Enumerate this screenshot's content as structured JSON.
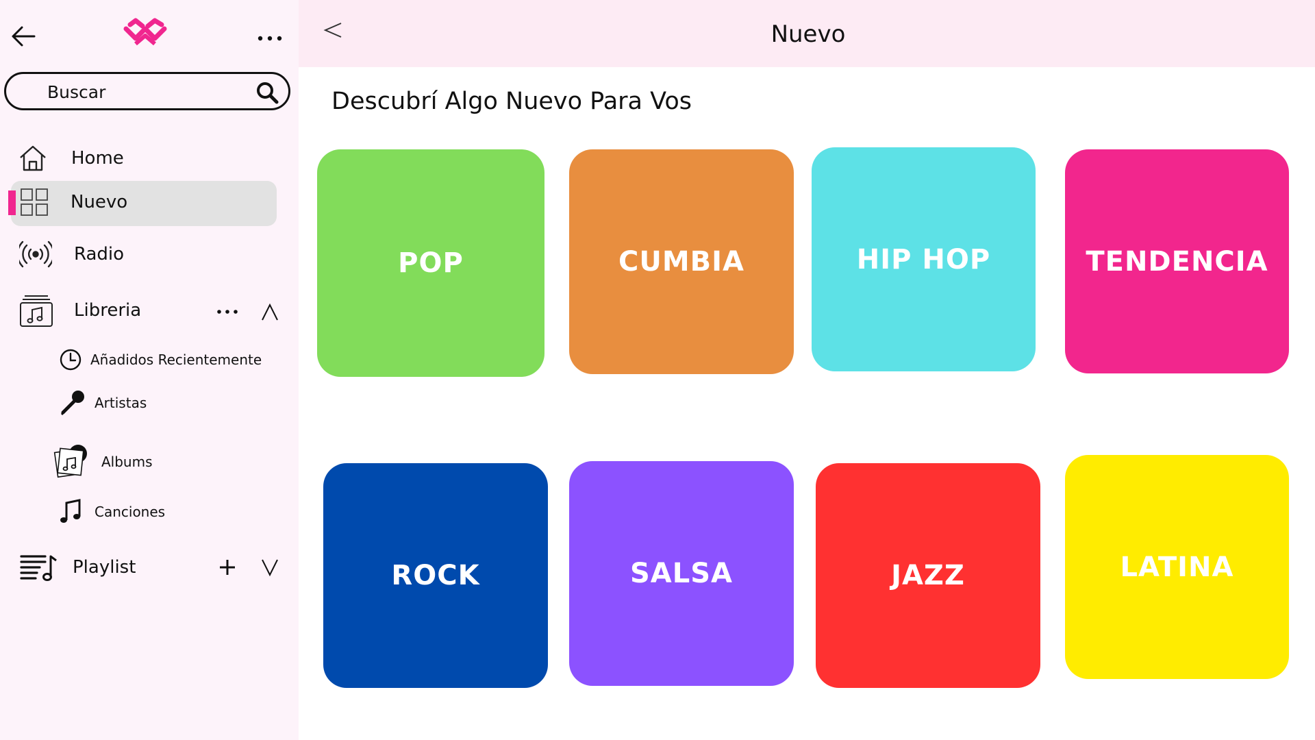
{
  "sidebar": {
    "search": {
      "placeholder": "Buscar",
      "value": ""
    },
    "nav": {
      "home": "Home",
      "nuevo": "Nuevo",
      "radio": "Radio",
      "libreria": "Libreria",
      "playlist": "Playlist"
    },
    "library_items": {
      "recent": "Añadidos Recientemente",
      "artists": "Artistas",
      "albums": "Albums",
      "songs": "Canciones"
    },
    "active_item": "Nuevo",
    "accent_color": "#f0268f"
  },
  "header": {
    "title": "Nuevo"
  },
  "main": {
    "section_title": "Descubrí Algo Nuevo Para Vos",
    "genres": [
      {
        "label": "POP",
        "color": "#82dc5a"
      },
      {
        "label": "CUMBIA",
        "color": "#e88e3f"
      },
      {
        "label": "HIP HOP",
        "color": "#5de1e6"
      },
      {
        "label": "TENDENCIA",
        "color": "#f2268d"
      },
      {
        "label": "ROCK",
        "color": "#004aad"
      },
      {
        "label": "SALSA",
        "color": "#8c52ff"
      },
      {
        "label": "JAZZ",
        "color": "#ff3131"
      },
      {
        "label": "LATINA",
        "color": "#ffec00"
      }
    ]
  },
  "icons": {
    "logo": "brand-logo-icon",
    "back": "arrow-left-icon",
    "more": "more-horizontal-icon",
    "search": "search-icon",
    "home": "home-icon",
    "nuevo": "grid-icon",
    "radio": "radio-broadcast-icon",
    "libreria": "music-library-icon",
    "recent": "clock-icon",
    "artists": "microphone-icon",
    "albums": "album-icon",
    "songs": "music-note-icon",
    "playlist": "playlist-icon",
    "add": "plus-icon",
    "collapse": "chevron-up-icon",
    "expand": "chevron-down-icon"
  }
}
